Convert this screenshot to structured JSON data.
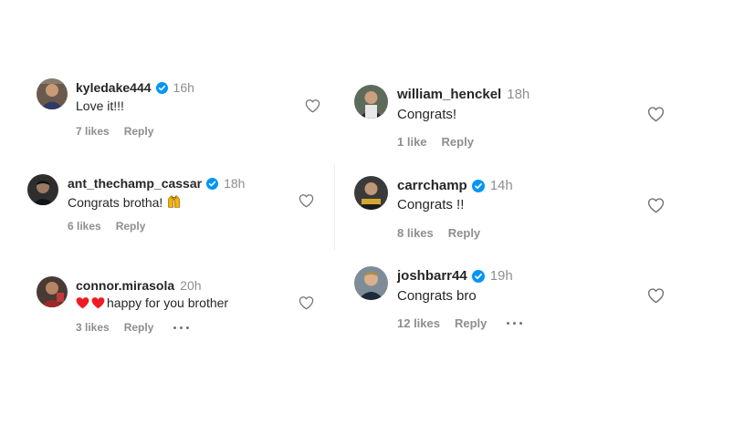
{
  "comments": [
    {
      "username": "kyledake444",
      "verified": true,
      "time": "16h",
      "text": "Love it!!!",
      "likes": "7 likes",
      "reply": "Reply",
      "more": false
    },
    {
      "username": "ant_thechamp_cassar",
      "verified": true,
      "time": "18h",
      "text": "Congrats brotha!",
      "emoji": "raised-hands-emoji",
      "likes": "6 likes",
      "reply": "Reply",
      "more": false
    },
    {
      "username": "connor.mirasola",
      "verified": false,
      "time": "20h",
      "emoji_prefix": "red-heart-emoji x2",
      "text": "happy for you brother",
      "likes": "3 likes",
      "reply": "Reply",
      "more": true
    },
    {
      "username": "william_henckel",
      "verified": false,
      "time": "18h",
      "text": "Congrats!",
      "likes": "1 like",
      "reply": "Reply",
      "more": false
    },
    {
      "username": "carrchamp",
      "verified": true,
      "time": "14h",
      "text": "Congrats !!",
      "likes": "8 likes",
      "reply": "Reply",
      "more": false
    },
    {
      "username": "joshbarr44",
      "verified": true,
      "time": "19h",
      "text": "Congrats bro",
      "likes": "12 likes",
      "reply": "Reply",
      "more": true
    }
  ],
  "colors": {
    "verified": "#0095f6",
    "muted": "#8e8e8e",
    "text": "#262626",
    "heart": "#ed1c24"
  },
  "icons": {
    "like": "heart-outline-icon",
    "verified": "verified-badge-icon",
    "more": "more-options-icon"
  }
}
